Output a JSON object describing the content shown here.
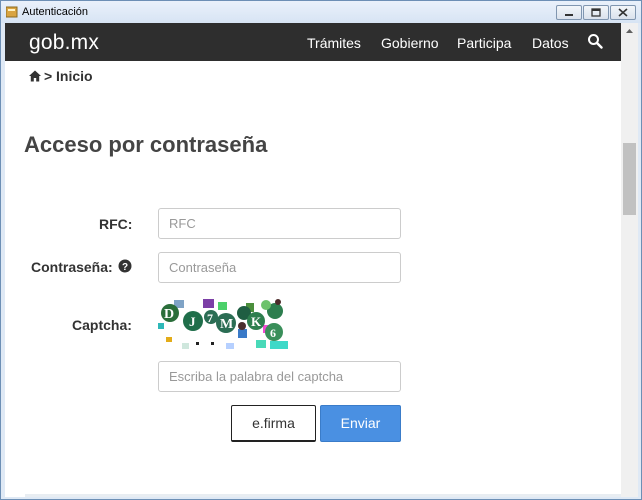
{
  "window": {
    "title": "Autenticación"
  },
  "nav": {
    "logo": "gob.mx",
    "links": [
      "Trámites",
      "Gobierno",
      "Participa",
      "Datos"
    ]
  },
  "breadcrumb": {
    "separator": ">",
    "label": "Inicio"
  },
  "page": {
    "heading": "Acceso por contraseña"
  },
  "form": {
    "rfc_label": "RFC:",
    "rfc_placeholder": "RFC",
    "password_label": "Contraseña:",
    "password_placeholder": "Contraseña",
    "captcha_label": "Captcha:",
    "captcha_placeholder": "Escriba la palabra del captcha",
    "captcha_text": "DJ7MK6"
  },
  "buttons": {
    "efirma": "e.firma",
    "enviar": "Enviar"
  },
  "colors": {
    "navbar": "#2e2e2e",
    "primary_button": "#4a90e2"
  }
}
